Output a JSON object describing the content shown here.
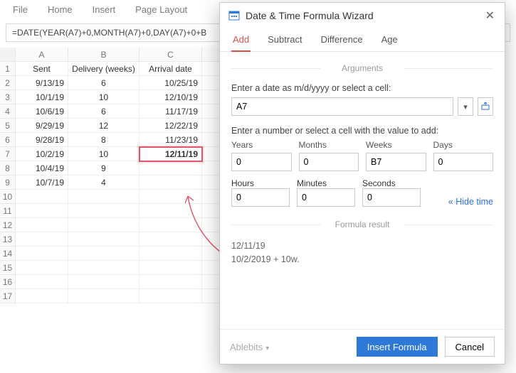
{
  "ribbon": {
    "file": "File",
    "home": "Home",
    "insert": "Insert",
    "page_layout": "Page Layout"
  },
  "formula": "=DATE(YEAR(A7)+0,MONTH(A7)+0,DAY(A7)+0+B",
  "columns": {
    "a": "A",
    "b": "B",
    "c": "C"
  },
  "headers": {
    "sent": "Sent",
    "delivery": "Delivery (weeks)",
    "arrival": "Arrival date"
  },
  "rows": [
    {
      "sent": "9/13/19",
      "weeks": "6",
      "arrival": "10/25/19"
    },
    {
      "sent": "10/1/19",
      "weeks": "10",
      "arrival": "12/10/19"
    },
    {
      "sent": "10/6/19",
      "weeks": "6",
      "arrival": "11/17/19"
    },
    {
      "sent": "9/29/19",
      "weeks": "12",
      "arrival": "12/22/19"
    },
    {
      "sent": "9/28/19",
      "weeks": "8",
      "arrival": "11/23/19"
    },
    {
      "sent": "10/2/19",
      "weeks": "10",
      "arrival": "12/11/19"
    },
    {
      "sent": "10/4/19",
      "weeks": "9",
      "arrival": ""
    },
    {
      "sent": "10/7/19",
      "weeks": "4",
      "arrival": ""
    }
  ],
  "dialog": {
    "title": "Date & Time Formula Wizard",
    "tabs": {
      "add": "Add",
      "subtract": "Subtract",
      "difference": "Difference",
      "age": "Age"
    },
    "section_arguments": "Arguments",
    "label_date": "Enter a date as m/d/yyyy or select a cell:",
    "date_value": "A7",
    "label_number": "Enter a number or select a cell with the value to add:",
    "units": {
      "years": {
        "label": "Years",
        "value": "0"
      },
      "months": {
        "label": "Months",
        "value": "0"
      },
      "weeks": {
        "label": "Weeks",
        "value": "B7"
      },
      "days": {
        "label": "Days",
        "value": "0"
      },
      "hours": {
        "label": "Hours",
        "value": "0"
      },
      "minutes": {
        "label": "Minutes",
        "value": "0"
      },
      "seconds": {
        "label": "Seconds",
        "value": "0"
      }
    },
    "hide_time": "Hide time",
    "section_result": "Formula result",
    "result_line1": "12/11/19",
    "result_line2": "10/2/2019 + 10w.",
    "brand": "Ablebits",
    "btn_insert": "Insert Formula",
    "btn_cancel": "Cancel"
  }
}
